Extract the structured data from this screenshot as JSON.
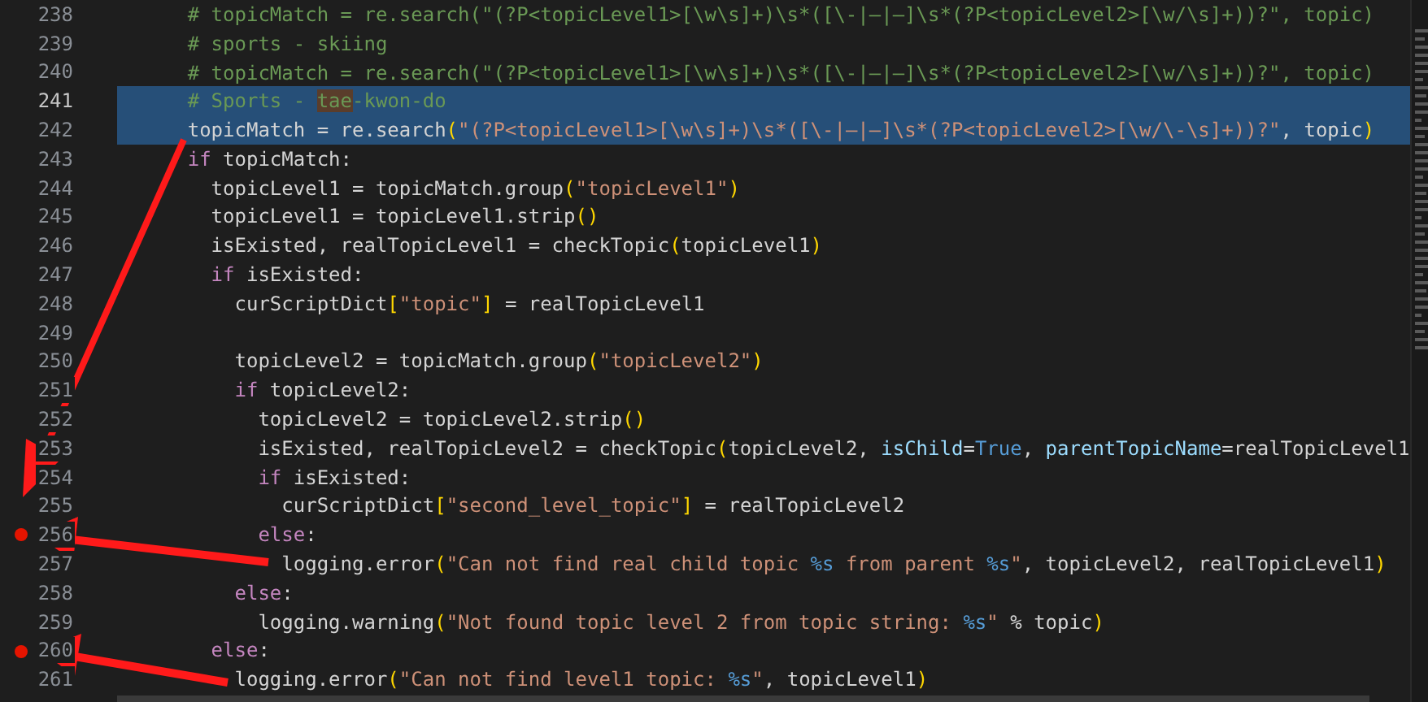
{
  "editor": {
    "lines": [
      {
        "number": "238",
        "selected": false,
        "current": false,
        "breakpoint": false,
        "tokens": [
          {
            "kind": "comment",
            "text": "      # topicMatch = re.search(\"(?P<topicLevel1>[\\w\\s]+)\\s*([\\-|–|—]\\s*(?P<topicLevel2>[\\w/\\s]+))?\", topic)"
          }
        ]
      },
      {
        "number": "239",
        "selected": false,
        "current": false,
        "breakpoint": false,
        "tokens": [
          {
            "kind": "comment",
            "text": "      # sports - skiing"
          }
        ]
      },
      {
        "number": "240",
        "selected": false,
        "current": false,
        "breakpoint": false,
        "tokens": [
          {
            "kind": "comment",
            "text": "      # topicMatch = re.search(\"(?P<topicLevel1>[\\w\\s]+)\\s*([\\-|–|—]\\s*(?P<topicLevel2>[\\w/\\s]+))?\", topic)"
          }
        ]
      },
      {
        "number": "241",
        "selected": true,
        "current": true,
        "breakpoint": false,
        "tokens": [
          {
            "kind": "comment",
            "text": "      # Sports - "
          },
          {
            "kind": "match",
            "text": "tae"
          },
          {
            "kind": "comment",
            "text": "-kwon-do"
          }
        ]
      },
      {
        "number": "242",
        "selected": true,
        "current": false,
        "breakpoint": false,
        "tokens": [
          {
            "kind": "plain",
            "text": "      topicMatch = re.search"
          },
          {
            "kind": "bracket",
            "text": "("
          },
          {
            "kind": "string",
            "text": "\"(?P<topicLevel1>[\\w\\s]+)\\s*([\\-|–|—]\\s*(?P<topicLevel2>[\\w/\\-\\s]+))?\""
          },
          {
            "kind": "plain",
            "text": ", topic"
          },
          {
            "kind": "bracket",
            "text": ")"
          }
        ]
      },
      {
        "number": "243",
        "selected": false,
        "current": false,
        "breakpoint": false,
        "tokens": [
          {
            "kind": "keyword",
            "text": "      if"
          },
          {
            "kind": "plain",
            "text": " topicMatch:"
          }
        ]
      },
      {
        "number": "244",
        "selected": false,
        "current": false,
        "breakpoint": false,
        "tokens": [
          {
            "kind": "plain",
            "text": "        topicLevel1 = topicMatch.group"
          },
          {
            "kind": "bracket",
            "text": "("
          },
          {
            "kind": "string",
            "text": "\"topicLevel1\""
          },
          {
            "kind": "bracket",
            "text": ")"
          }
        ]
      },
      {
        "number": "245",
        "selected": false,
        "current": false,
        "breakpoint": false,
        "tokens": [
          {
            "kind": "plain",
            "text": "        topicLevel1 = topicLevel1.strip"
          },
          {
            "kind": "bracket",
            "text": "()"
          }
        ]
      },
      {
        "number": "246",
        "selected": false,
        "current": false,
        "breakpoint": false,
        "tokens": [
          {
            "kind": "plain",
            "text": "        isExisted, realTopicLevel1 = checkTopic"
          },
          {
            "kind": "bracket",
            "text": "("
          },
          {
            "kind": "plain",
            "text": "topicLevel1"
          },
          {
            "kind": "bracket",
            "text": ")"
          }
        ]
      },
      {
        "number": "247",
        "selected": false,
        "current": false,
        "breakpoint": false,
        "tokens": [
          {
            "kind": "keyword",
            "text": "        if"
          },
          {
            "kind": "plain",
            "text": " isExisted:"
          }
        ]
      },
      {
        "number": "248",
        "selected": false,
        "current": false,
        "breakpoint": false,
        "tokens": [
          {
            "kind": "plain",
            "text": "          curScriptDict"
          },
          {
            "kind": "bracket",
            "text": "["
          },
          {
            "kind": "string",
            "text": "\"topic\""
          },
          {
            "kind": "bracket",
            "text": "]"
          },
          {
            "kind": "plain",
            "text": " = realTopicLevel1"
          }
        ]
      },
      {
        "number": "249",
        "selected": false,
        "current": false,
        "breakpoint": false
      },
      {
        "number": "250",
        "selected": false,
        "current": false,
        "breakpoint": false,
        "tokens": [
          {
            "kind": "plain",
            "text": "          topicLevel2 = topicMatch.group"
          },
          {
            "kind": "bracket",
            "text": "("
          },
          {
            "kind": "string",
            "text": "\"topicLevel2\""
          },
          {
            "kind": "bracket",
            "text": ")"
          }
        ]
      },
      {
        "number": "251",
        "selected": false,
        "current": false,
        "breakpoint": false,
        "tokens": [
          {
            "kind": "keyword",
            "text": "          if"
          },
          {
            "kind": "plain",
            "text": " topicLevel2:"
          }
        ]
      },
      {
        "number": "252",
        "selected": false,
        "current": false,
        "breakpoint": false,
        "tokens": [
          {
            "kind": "plain",
            "text": "            topicLevel2 = topicLevel2.strip"
          },
          {
            "kind": "bracket",
            "text": "()"
          }
        ]
      },
      {
        "number": "253",
        "selected": false,
        "current": false,
        "breakpoint": false,
        "tokens": [
          {
            "kind": "plain",
            "text": "            isExisted, realTopicLevel2 = checkTopic"
          },
          {
            "kind": "bracket",
            "text": "("
          },
          {
            "kind": "plain",
            "text": "topicLevel2, "
          },
          {
            "kind": "param",
            "text": "isChild"
          },
          {
            "kind": "plain",
            "text": "="
          },
          {
            "kind": "constant",
            "text": "True"
          },
          {
            "kind": "plain",
            "text": ", "
          },
          {
            "kind": "param",
            "text": "parentTopicName"
          },
          {
            "kind": "plain",
            "text": "=realTopicLevel1"
          }
        ]
      },
      {
        "number": "254",
        "selected": false,
        "current": false,
        "breakpoint": false,
        "tokens": [
          {
            "kind": "keyword",
            "text": "            if"
          },
          {
            "kind": "plain",
            "text": " isExisted:"
          }
        ]
      },
      {
        "number": "255",
        "selected": false,
        "current": false,
        "breakpoint": false,
        "tokens": [
          {
            "kind": "plain",
            "text": "              curScriptDict"
          },
          {
            "kind": "bracket",
            "text": "["
          },
          {
            "kind": "string",
            "text": "\"second_level_topic\""
          },
          {
            "kind": "bracket",
            "text": "]"
          },
          {
            "kind": "plain",
            "text": " = realTopicLevel2"
          }
        ]
      },
      {
        "number": "256",
        "selected": false,
        "current": false,
        "breakpoint": true,
        "tokens": [
          {
            "kind": "keyword",
            "text": "            else"
          },
          {
            "kind": "plain",
            "text": ":"
          }
        ]
      },
      {
        "number": "257",
        "selected": false,
        "current": false,
        "breakpoint": false,
        "tokens": [
          {
            "kind": "plain",
            "text": "              logging.error"
          },
          {
            "kind": "bracket",
            "text": "("
          },
          {
            "kind": "string",
            "text": "\"Can not find real child topic "
          },
          {
            "kind": "format",
            "text": "%s"
          },
          {
            "kind": "string",
            "text": " from parent "
          },
          {
            "kind": "format",
            "text": "%s"
          },
          {
            "kind": "string",
            "text": "\""
          },
          {
            "kind": "plain",
            "text": ", topicLevel2, realTopicLevel1"
          },
          {
            "kind": "bracket",
            "text": ")"
          }
        ]
      },
      {
        "number": "258",
        "selected": false,
        "current": false,
        "breakpoint": false,
        "tokens": [
          {
            "kind": "keyword",
            "text": "          else"
          },
          {
            "kind": "plain",
            "text": ":"
          }
        ]
      },
      {
        "number": "259",
        "selected": false,
        "current": false,
        "breakpoint": false,
        "tokens": [
          {
            "kind": "plain",
            "text": "            logging.warning"
          },
          {
            "kind": "bracket",
            "text": "("
          },
          {
            "kind": "string",
            "text": "\"Not found topic level 2 from topic string: "
          },
          {
            "kind": "format",
            "text": "%s"
          },
          {
            "kind": "string",
            "text": "\""
          },
          {
            "kind": "plain",
            "text": " % topic"
          },
          {
            "kind": "bracket",
            "text": ")"
          }
        ]
      },
      {
        "number": "260",
        "selected": false,
        "current": false,
        "breakpoint": true,
        "tokens": [
          {
            "kind": "keyword",
            "text": "        else"
          },
          {
            "kind": "plain",
            "text": ":"
          }
        ]
      },
      {
        "number": "261",
        "selected": false,
        "current": false,
        "breakpoint": false,
        "tokens": [
          {
            "kind": "plain",
            "text": "          logging.error"
          },
          {
            "kind": "bracket",
            "text": "("
          },
          {
            "kind": "string",
            "text": "\"Can not find level1 topic: "
          },
          {
            "kind": "format",
            "text": "%s"
          },
          {
            "kind": "string",
            "text": "\""
          },
          {
            "kind": "plain",
            "text": ", topicLevel1"
          },
          {
            "kind": "bracket",
            "text": ")"
          }
        ]
      }
    ]
  }
}
